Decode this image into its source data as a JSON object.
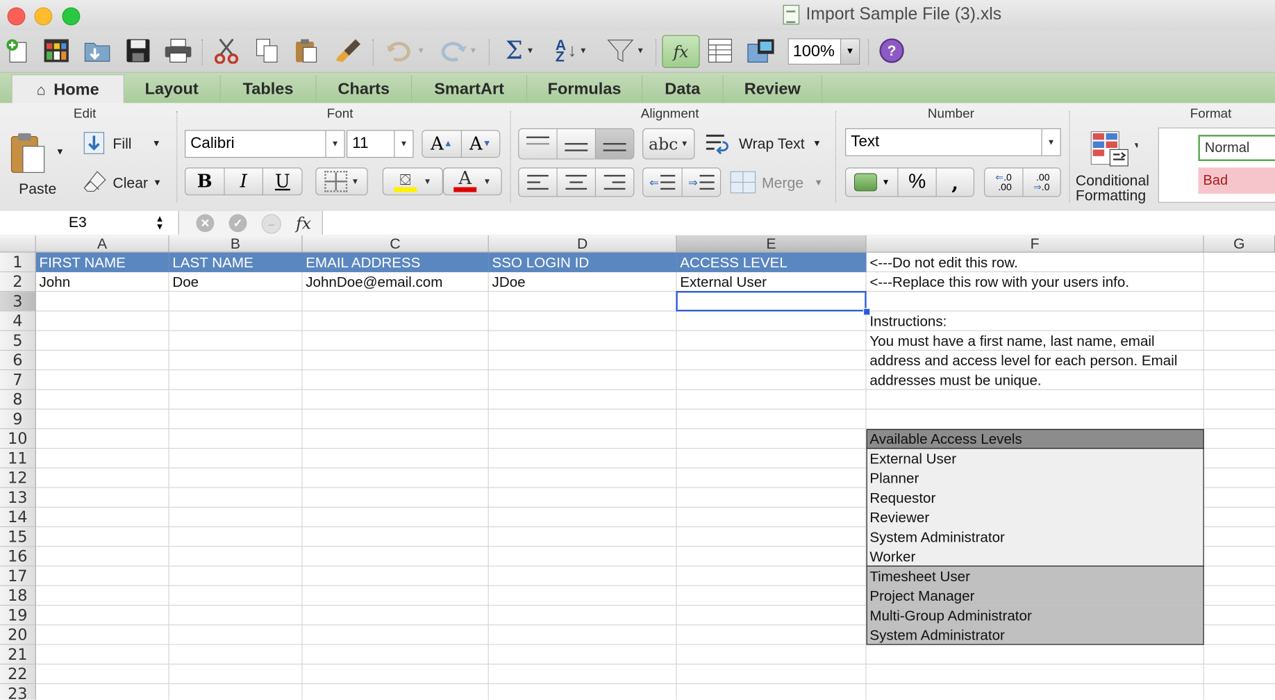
{
  "window": {
    "title": "Import Sample File (3).xls"
  },
  "toolbar": {
    "zoom": "100%"
  },
  "tabs": [
    {
      "label": "Home"
    },
    {
      "label": "Layout"
    },
    {
      "label": "Tables"
    },
    {
      "label": "Charts"
    },
    {
      "label": "SmartArt"
    },
    {
      "label": "Formulas"
    },
    {
      "label": "Data"
    },
    {
      "label": "Review"
    }
  ],
  "ribbon": {
    "groups": {
      "edit": "Edit",
      "font": "Font",
      "alignment": "Alignment",
      "number": "Number",
      "format": "Format"
    },
    "paste": "Paste",
    "fill": "Fill",
    "clear": "Clear",
    "font_name": "Calibri",
    "font_size": "11",
    "bold": "B",
    "italic": "I",
    "underline": "U",
    "wrap_text": "Wrap Text",
    "merge": "Merge",
    "abc": "abc",
    "number_format": "Text",
    "percent": "%",
    "comma": ",",
    "conditional_formatting": "Conditional Formatting",
    "style_normal": "Normal",
    "style_bad": "Bad"
  },
  "formula_bar": {
    "cell_ref": "E3",
    "fx": "fx",
    "value": ""
  },
  "columns": [
    "A",
    "B",
    "C",
    "D",
    "E",
    "F",
    "G"
  ],
  "rows": [
    "1",
    "2",
    "3",
    "4",
    "5",
    "6",
    "7",
    "8",
    "9",
    "10",
    "11",
    "12",
    "13",
    "14",
    "15",
    "16",
    "17",
    "18",
    "19",
    "20",
    "21",
    "22",
    "23"
  ],
  "sheet": {
    "headers": [
      "FIRST NAME",
      "LAST NAME",
      "EMAIL ADDRESS",
      "SSO LOGIN ID",
      "ACCESS LEVEL"
    ],
    "row2": [
      "John",
      "Doe",
      "JohnDoe@email.com",
      "JDoe",
      "External User"
    ],
    "f1": "<---Do not edit this row.",
    "f2": "<---Replace this row with your users info.",
    "instructions_title": "Instructions:",
    "instructions_lines": [
      "You must have a first name, last name, email",
      "address and access level for each person.  Email",
      "addresses must be unique."
    ],
    "levels_title": "Available Access Levels",
    "levels": [
      "External User",
      "Planner",
      "Requestor",
      "Reviewer",
      "System Administrator",
      "Worker"
    ],
    "levels_extra": [
      "Timesheet User",
      "Project Manager",
      "Multi-Group Administrator",
      "System Administrator"
    ]
  },
  "colors": {
    "header_fill": "#5b87c0",
    "level_gray": "#c0c0c0",
    "level_title": "#8c8c8c",
    "selection": "#2a5bd7"
  }
}
